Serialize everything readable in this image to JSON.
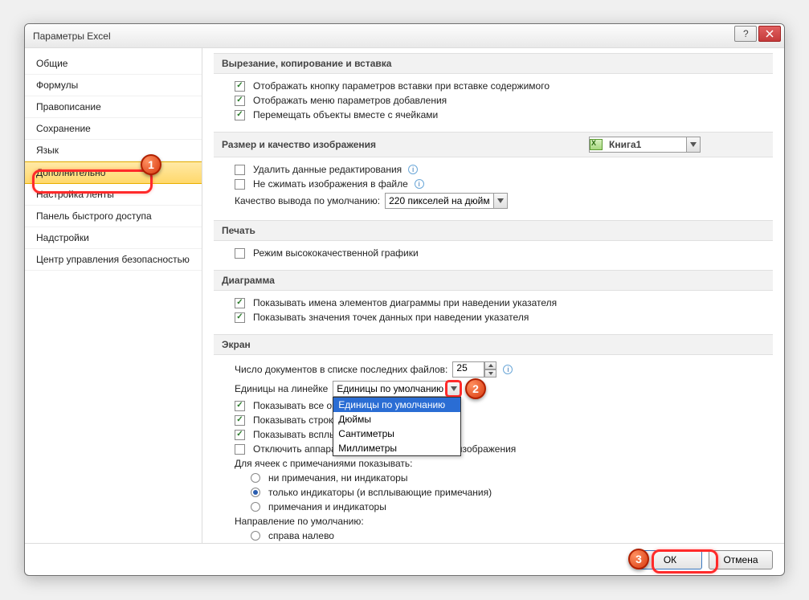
{
  "window": {
    "title": "Параметры Excel"
  },
  "sidebar": {
    "items": [
      {
        "label": "Общие"
      },
      {
        "label": "Формулы"
      },
      {
        "label": "Правописание"
      },
      {
        "label": "Сохранение"
      },
      {
        "label": "Язык"
      },
      {
        "label": "Дополнительно"
      },
      {
        "label": "Настройка ленты"
      },
      {
        "label": "Панель быстрого доступа"
      },
      {
        "label": "Надстройки"
      },
      {
        "label": "Центр управления безопасностью"
      }
    ],
    "selected_index": 5
  },
  "sections": {
    "cutcopy": {
      "header": "Вырезание, копирование и вставка",
      "opt1": "Отображать кнопку параметров вставки при вставке содержимого",
      "opt2": "Отображать меню параметров добавления",
      "opt3": "Перемещать объекты вместе с ячейками"
    },
    "image": {
      "header": "Размер и качество изображения",
      "book": "Книга1",
      "del_edit": "Удалить данные редактирования",
      "no_compress": "Не сжимать изображения в файле",
      "quality_label": "Качество вывода по умолчанию:",
      "quality_value": "220 пикселей на дюйм"
    },
    "print": {
      "header": "Печать",
      "high_quality": "Режим высококачественной графики"
    },
    "chart": {
      "header": "Диаграмма",
      "show_elem_names": "Показывать имена элементов диаграммы при наведении указателя",
      "show_point_values": "Показывать значения точек данных при наведении указателя"
    },
    "screen": {
      "header": "Экран",
      "recent_docs_label": "Число документов в списке последних файлов:",
      "recent_docs_value": "25",
      "ruler_units_label": "Единицы на линейке",
      "ruler_units_value": "Единицы по умолчанию",
      "dropdown_options": [
        "Единицы по умолчанию",
        "Дюймы",
        "Сантиметры",
        "Миллиметры"
      ],
      "show_all_windows": "Показывать все окн",
      "show_formula_bar": "Показывать строку",
      "show_tooltips": "Показывать всплы",
      "disable_hw_accel": "Отключить аппаратное ускорение обработки изображения",
      "cell_comments_label": "Для ячеек с примечаниями показывать:",
      "cell_comments_opts": [
        "ни примечания, ни индикаторы",
        "только индикаторы (и всплывающие примечания)",
        "примечания и индикаторы"
      ],
      "cell_comments_selected": 1,
      "direction_label": "Направление по умолчанию:",
      "direction_opt": "справа налево"
    }
  },
  "footer": {
    "ok": "ОК",
    "cancel": "Отмена"
  },
  "callouts": {
    "c1": "1",
    "c2": "2",
    "c3": "3"
  }
}
